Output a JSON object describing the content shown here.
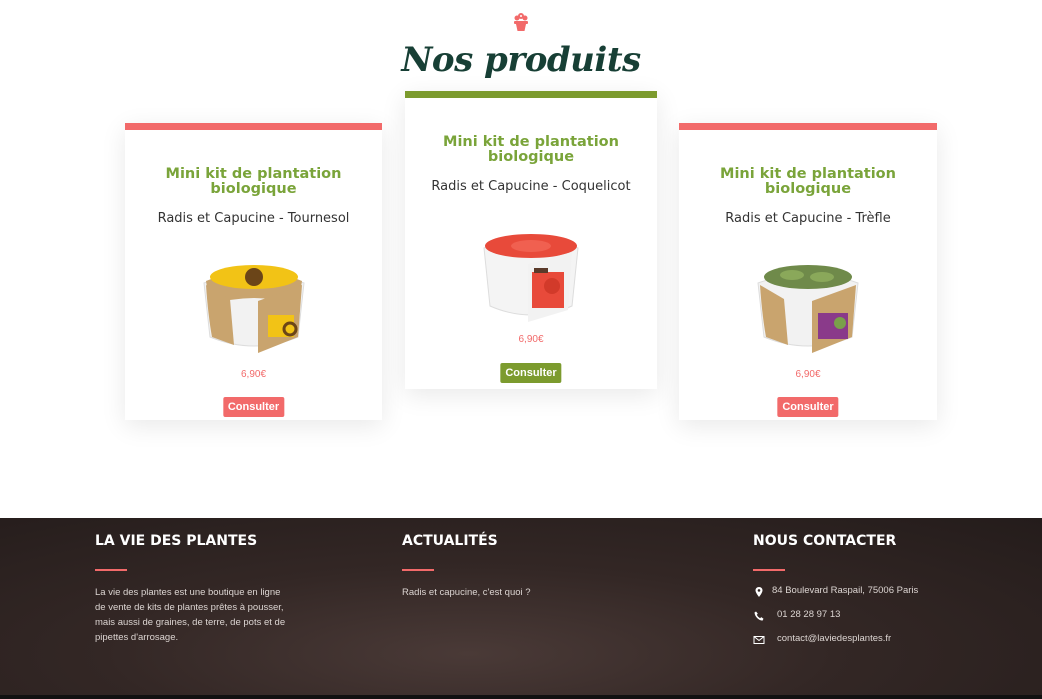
{
  "section": {
    "title": "Nos produits",
    "icon": "flower-pot-icon"
  },
  "products": [
    {
      "title": "Mini kit de plantation biologique",
      "subtitle": "Radis et Capucine - Tournesol",
      "price": "6,90€",
      "button": "Consulter",
      "accent": "#f26a6a"
    },
    {
      "title": "Mini kit de plantation biologique",
      "subtitle": "Radis et Capucine - Coquelicot",
      "price": "6,90€",
      "button": "Consulter",
      "accent": "#7c9b2e"
    },
    {
      "title": "Mini kit de plantation biologique",
      "subtitle": "Radis et Capucine - Trèfle",
      "price": "6,90€",
      "button": "Consulter",
      "accent": "#f26a6a"
    }
  ],
  "footer": {
    "about": {
      "title": "LA VIE DES PLANTES",
      "lines": [
        "La vie des plantes est une boutique en ligne",
        "de vente de kits de plantes prêtes à pousser,",
        "mais aussi de graines, de terre, de pots et de",
        "pipettes d'arrosage."
      ]
    },
    "news": {
      "title": "ACTUALITÉS",
      "link": "Radis et capucine, c'est quoi ?"
    },
    "contact": {
      "title": "NOUS CONTACTER",
      "address": "84 Boulevard Raspail, 75006 Paris",
      "phone": "01 28 28 97 13",
      "email": "contact@laviedesplantes.fr"
    }
  },
  "colors": {
    "coral": "#f26a6a",
    "green": "#7c9b2e",
    "title": "#173f35",
    "footer_bg": "#2e2422"
  }
}
